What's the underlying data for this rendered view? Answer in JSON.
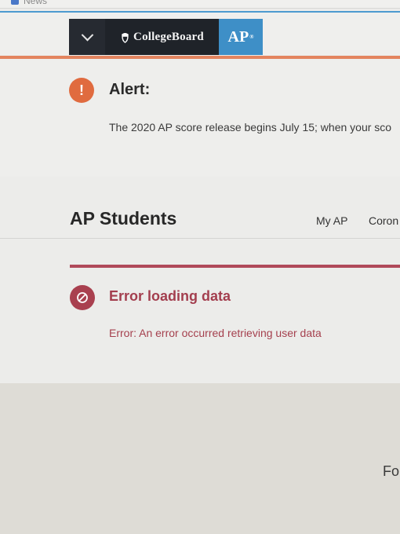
{
  "browser": {
    "bookmark_label": "News"
  },
  "header": {
    "brand": "CollegeBoard",
    "program": "AP",
    "program_mark": "®"
  },
  "alert": {
    "title": "Alert:",
    "icon_symbol": "!",
    "message": "The 2020 AP score release begins July 15; when your sco"
  },
  "section": {
    "title": "AP Students",
    "nav": [
      "My AP",
      "Coron"
    ]
  },
  "error": {
    "title": "Error loading data",
    "message": "Error: An error occurred retrieving user data"
  },
  "footer": {
    "partial_text": "Fo"
  },
  "colors": {
    "accent_blue": "#3e8fc7",
    "alert_orange": "#e06b3f",
    "error_red": "#a9404f"
  }
}
